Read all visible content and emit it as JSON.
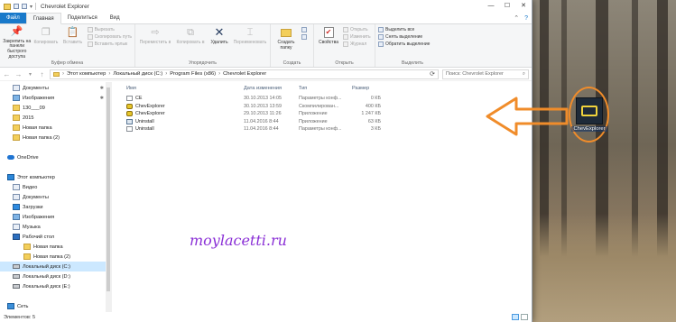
{
  "window": {
    "title": "Chevrolet Explorer",
    "controls": [
      "—",
      "☐",
      "✕"
    ]
  },
  "ribbon_tabs": [
    {
      "label": "Файл",
      "kind": "file"
    },
    {
      "label": "Главная",
      "kind": "active"
    },
    {
      "label": "Поделиться",
      "kind": "normal"
    },
    {
      "label": "Вид",
      "kind": "normal"
    }
  ],
  "ribbon": {
    "clipboard": {
      "label": "Буфер обмена",
      "pin": "Закрепить на панели быстрого доступа",
      "copy": "Копировать",
      "paste": "Вставить",
      "cut": "Вырезать",
      "copy_path": "Скопировать путь",
      "paste_shortcut": "Вставить ярлык"
    },
    "organize": {
      "label": "Упорядочить",
      "move_to": "Переместить в",
      "copy_to": "Копировать в",
      "delete": "Удалить",
      "rename": "Переименовать"
    },
    "new": {
      "label": "Создать",
      "new_folder": "Создать папку"
    },
    "open": {
      "label": "Открыть",
      "properties": "Свойства",
      "open": "Открыть",
      "edit": "Изменить",
      "history": "Журнал"
    },
    "select": {
      "label": "Выделить",
      "select_all": "Выделить все",
      "select_none": "Снять выделение",
      "invert": "Обратить выделение"
    }
  },
  "address": {
    "segments": [
      "Этот компьютер",
      "Локальный диск (C:)",
      "Program Files (x86)",
      "Chevrolet Explorer"
    ],
    "search_placeholder": "Поиск: Chevrolet Explorer"
  },
  "nav_items": [
    {
      "label": "Документы",
      "icon": "docs",
      "indent": 6,
      "pinned": true
    },
    {
      "label": "Изображения",
      "icon": "pics",
      "indent": 6,
      "pinned": true
    },
    {
      "label": "130___09",
      "icon": "folder",
      "indent": 6,
      "pinned": false
    },
    {
      "label": "2015",
      "icon": "folder",
      "indent": 6,
      "pinned": false
    },
    {
      "label": "Новая папка",
      "icon": "folder",
      "indent": 6,
      "pinned": false
    },
    {
      "label": "Новая папка (2)",
      "icon": "folder",
      "indent": 6,
      "pinned": false
    },
    {
      "label": "",
      "icon": "",
      "indent": 0,
      "pinned": false
    },
    {
      "label": "OneDrive",
      "icon": "cloud",
      "indent": 0,
      "pinned": false
    },
    {
      "label": "",
      "icon": "",
      "indent": 0,
      "pinned": false
    },
    {
      "label": "Этот компьютер",
      "icon": "pc",
      "indent": 0,
      "pinned": false
    },
    {
      "label": "Видео",
      "icon": "video",
      "indent": 6,
      "pinned": false
    },
    {
      "label": "Документы",
      "icon": "docs",
      "indent": 6,
      "pinned": false
    },
    {
      "label": "Загрузки",
      "icon": "down",
      "indent": 6,
      "pinned": false
    },
    {
      "label": "Изображения",
      "icon": "pics",
      "indent": 6,
      "pinned": false
    },
    {
      "label": "Музыка",
      "icon": "music",
      "indent": 6,
      "pinned": false
    },
    {
      "label": "Рабочий стол",
      "icon": "desk",
      "indent": 6,
      "pinned": false
    },
    {
      "label": "Новая папка",
      "icon": "folder",
      "indent": 18,
      "pinned": false
    },
    {
      "label": "Новая папка (2)",
      "icon": "folder",
      "indent": 18,
      "pinned": false
    },
    {
      "label": "Локальный диск (C:)",
      "icon": "disk",
      "indent": 6,
      "pinned": false,
      "selected": true
    },
    {
      "label": "Локальный диск (D:)",
      "icon": "disk",
      "indent": 6,
      "pinned": false
    },
    {
      "label": "Локальный диск (E:)",
      "icon": "disk",
      "indent": 6,
      "pinned": false
    },
    {
      "label": "",
      "icon": "",
      "indent": 0,
      "pinned": false
    },
    {
      "label": "Сеть",
      "icon": "net",
      "indent": 0,
      "pinned": false
    }
  ],
  "columns": {
    "name": "Имя",
    "date": "Дата изменения",
    "type": "Тип",
    "size": "Размер"
  },
  "files": [
    {
      "name": "CE",
      "date": "30.10.2013 14:05",
      "type": "Параметры конф...",
      "size": "0 КБ",
      "icon": "ini"
    },
    {
      "name": "ChevExplorer",
      "date": "30.10.2013 13:59",
      "type": "Скомпилирован...",
      "size": "400 КБ",
      "icon": "app"
    },
    {
      "name": "ChevExplorer",
      "date": "29.10.2013 11:26",
      "type": "Приложение",
      "size": "1 247 КБ",
      "icon": "app"
    },
    {
      "name": "Uninstall",
      "date": "11.04.2016 8:44",
      "type": "Приложение",
      "size": "63 КБ",
      "icon": "uninst"
    },
    {
      "name": "Uninstall",
      "date": "11.04.2016 8:44",
      "type": "Параметры конф...",
      "size": "3 КБ",
      "icon": "ini"
    }
  ],
  "watermark": "moylacetti.ru",
  "status": {
    "items": "Элементов: 5"
  },
  "desktop_shortcut": {
    "label": "ChevExplorer"
  },
  "colors": {
    "accent": "#1979ca",
    "annotation": "#f08c2a",
    "watermark": "#8a2fd6"
  }
}
